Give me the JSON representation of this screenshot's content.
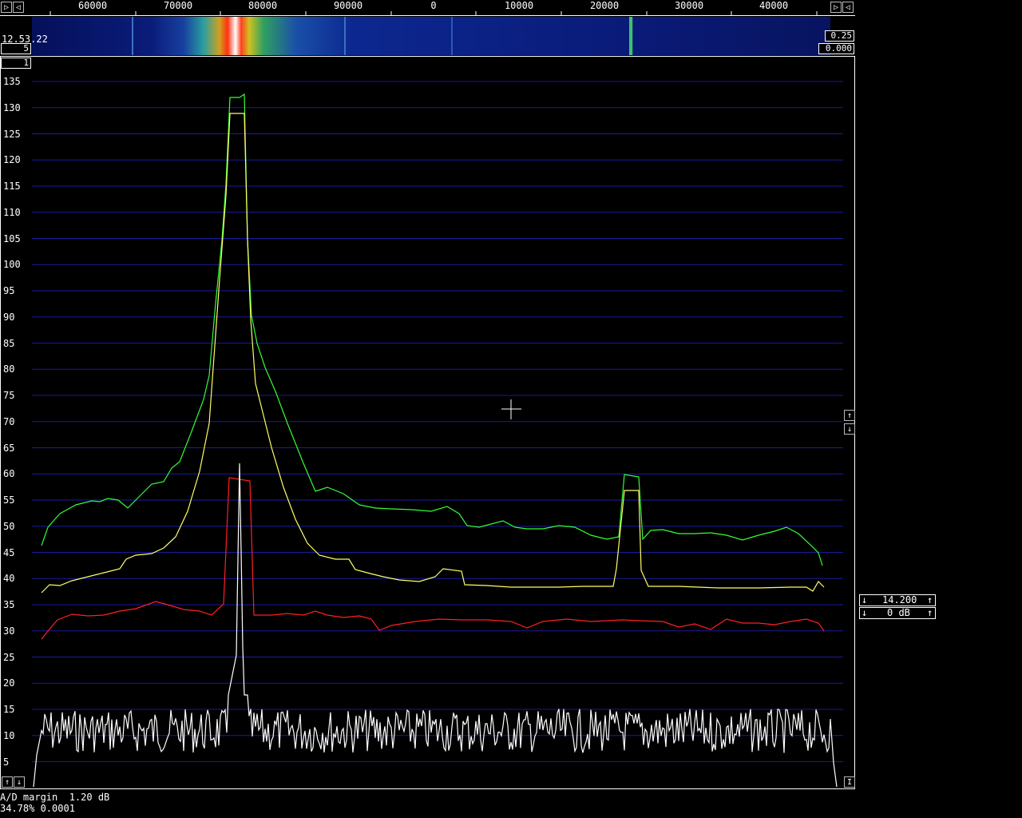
{
  "frequency_axis": {
    "labels": [
      "60000",
      "70000",
      "80000",
      "90000",
      "0",
      "10000",
      "20000",
      "30000",
      "40000"
    ]
  },
  "waterfall": {
    "time": "12.53.22",
    "avg_box": "5",
    "gain_box": "0.25",
    "zero_box": "0.000",
    "channel_box": "1"
  },
  "spectrum": {
    "y_labels": [
      "135",
      "130",
      "125",
      "120",
      "115",
      "110",
      "105",
      "100",
      "95",
      "90",
      "85",
      "80",
      "75",
      "70",
      "65",
      "60",
      "55",
      "50",
      "45",
      "40",
      "35",
      "30",
      "25",
      "20",
      "15",
      "10",
      "5"
    ]
  },
  "side_panel": {
    "value": "14.200",
    "db": "0 dB"
  },
  "status": {
    "line1": "A/D margin  1.20 dB",
    "line2": "34.78% 0.0001"
  },
  "icons": {
    "left": "◁",
    "right": "▷",
    "up": "↑",
    "down": "↓",
    "bar": "I"
  },
  "colors": {
    "grid": "#1a1aa0",
    "green": "#33ff33",
    "yellow": "#ffff66",
    "red": "#ff2020",
    "white": "#ffffff"
  }
}
